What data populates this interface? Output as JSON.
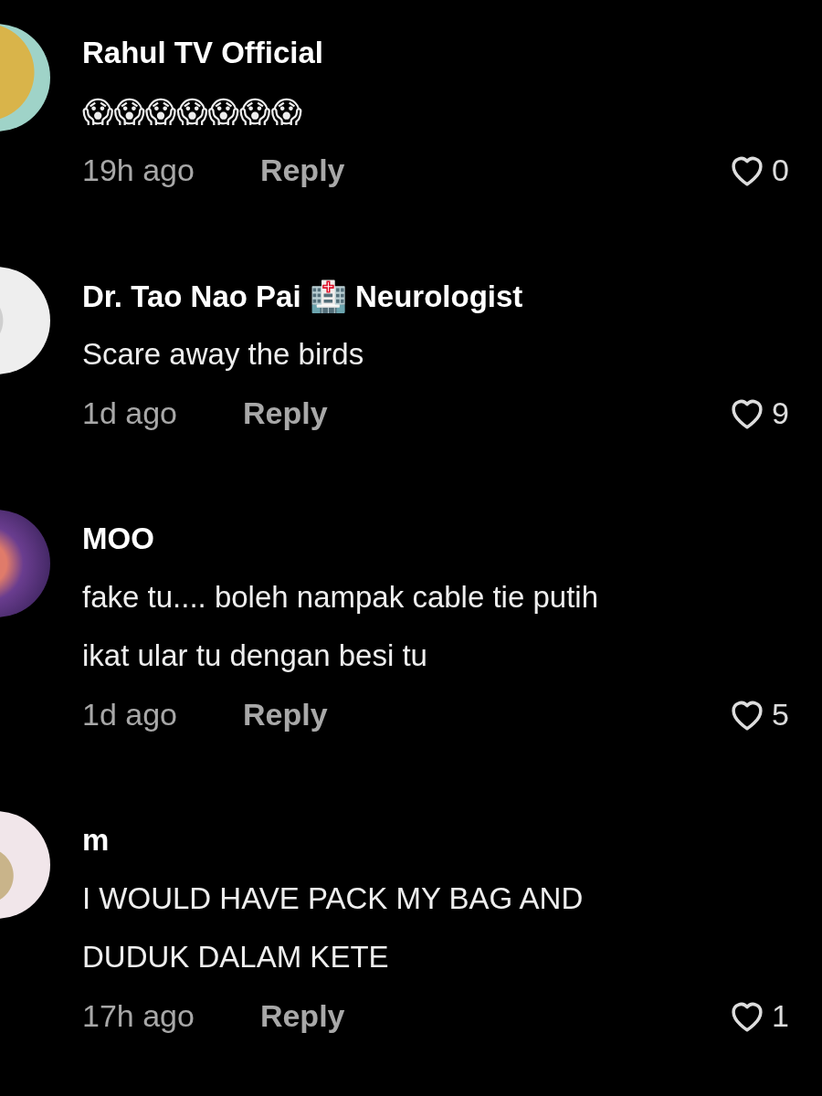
{
  "comments": [
    {
      "name": "Rahul TV Official",
      "body": [
        "😱😱😱😱😱😱😱"
      ],
      "time": "19h ago",
      "reply": "Reply",
      "likes": "0"
    },
    {
      "name": "Dr. Tao Nao Pai 🏥 Neurologist",
      "body": [
        "Scare away the birds"
      ],
      "time": "1d ago",
      "reply": "Reply",
      "likes": "9"
    },
    {
      "name": "MOO",
      "body": [
        "fake tu.... boleh nampak cable tie putih",
        "ikat ular tu dengan besi tu"
      ],
      "time": "1d ago",
      "reply": "Reply",
      "likes": "5"
    },
    {
      "name": "m",
      "body": [
        "I WOULD HAVE PACK MY BAG AND",
        "DUDUK DALAM KETE"
      ],
      "time": "17h ago",
      "reply": "Reply",
      "likes": "1"
    }
  ]
}
